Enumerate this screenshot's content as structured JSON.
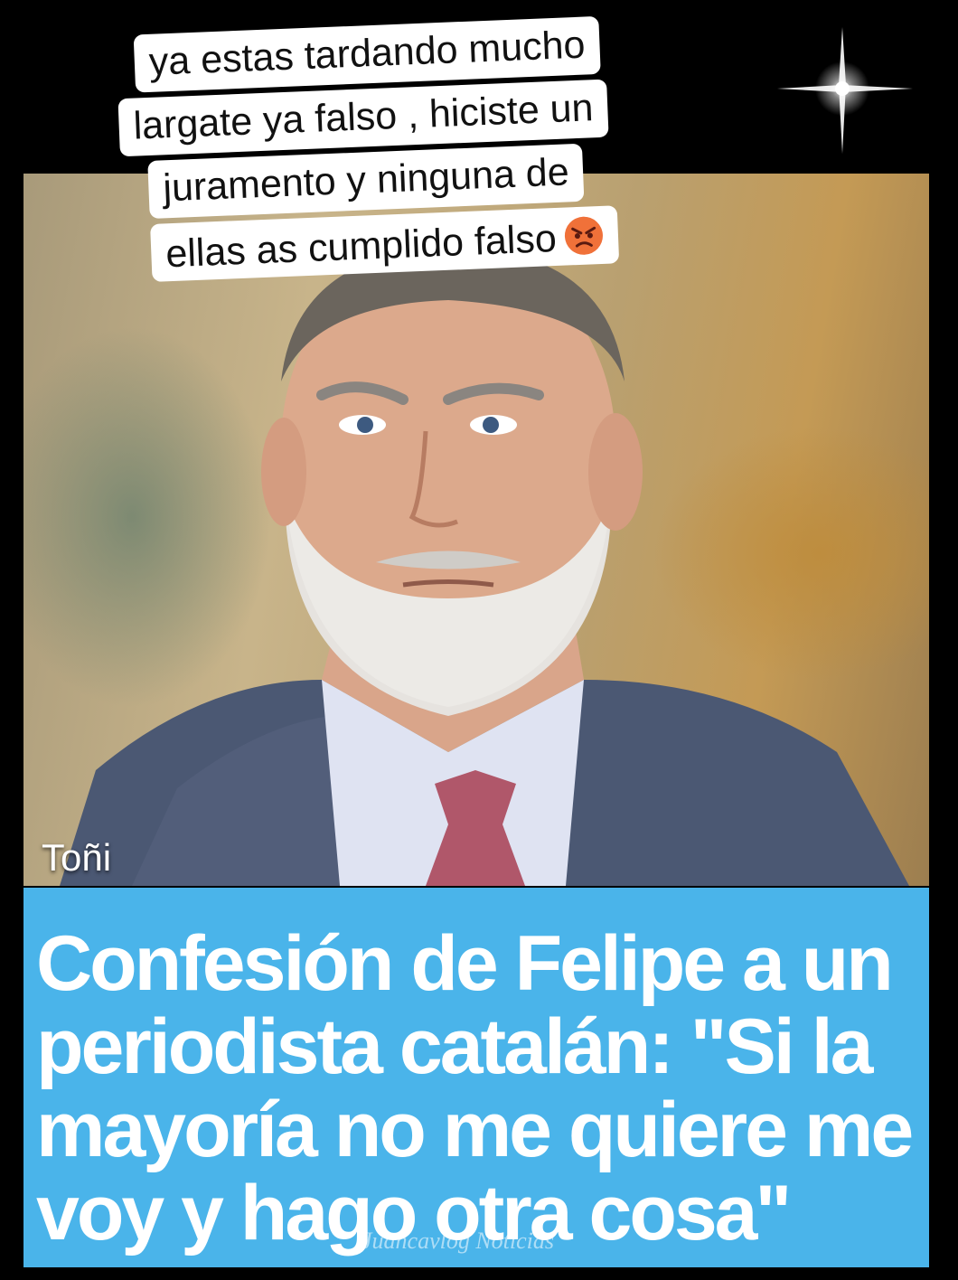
{
  "caption": {
    "lines": [
      "ya estas tardando mucho",
      "largate ya falso , hiciste un",
      "juramento  y ninguna de",
      "ellas as cumplido falso"
    ],
    "emoji_icon": "angry-face-icon"
  },
  "photo": {
    "subject": "portrait-photo"
  },
  "author": "Toñi",
  "headline": "Confesión de Felipe a un periodista catalán: \"Si la mayoría no me quiere me voy y hago otra cosa\"",
  "watermark": "Juancavlog Noticias",
  "colors": {
    "headline_bg": "#4ab4ea",
    "caption_bg": "#ffffff",
    "page_bg": "#000000"
  }
}
